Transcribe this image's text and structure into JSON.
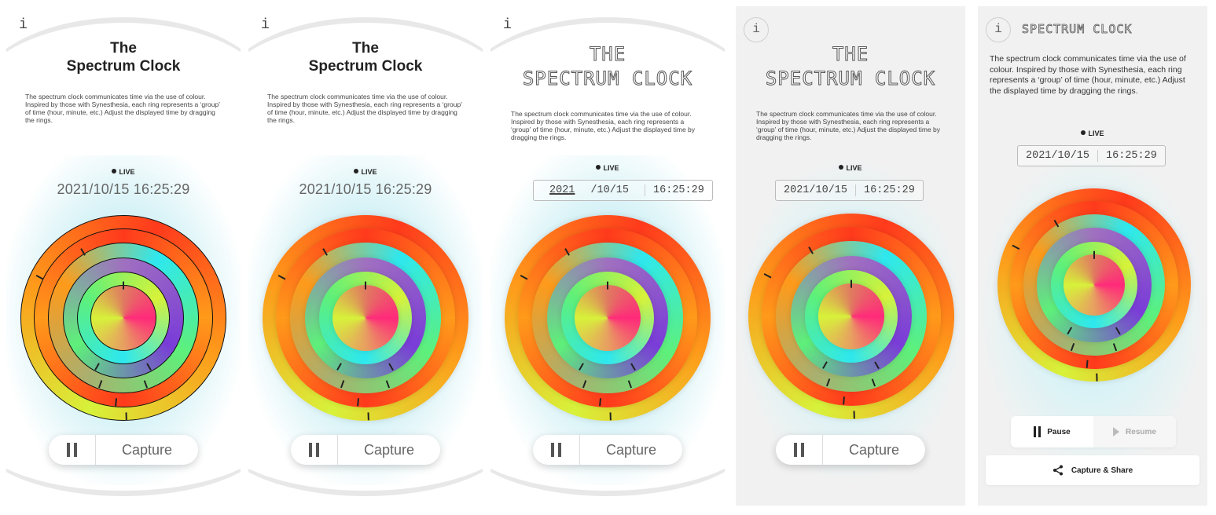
{
  "info_label": "i",
  "title_line1": "The",
  "title_line2": "Spectrum Clock",
  "title_upper_line1": "THE",
  "title_upper_line2": "SPECTRUM CLOCK",
  "description": "The spectrum clock communicates time via the use of colour. Inspired by those with Synesthesia, each ring represents a ‘group’ of time (hour, minute, etc.) Adjust the displayed time by dragging the rings.",
  "live_label": "LIVE",
  "datetime": "2021/10/15 16:25:29",
  "date": "2021/10/15",
  "date_year": "2021",
  "date_rest": "/10/15",
  "time": "16:25:29",
  "capture_label": "Capture",
  "pause_label": "Pause",
  "resume_label": "Resume",
  "capture_share_label": "Capture & Share",
  "colors": {
    "background": "#ffffff",
    "panel_gray": "#f1f1f1",
    "glow": "#bfeaf2",
    "ring_red": "#ff3a1c",
    "ring_orange": "#ff9a1a",
    "ring_yellow": "#d7f23a",
    "ring_cyan": "#2ee8ef",
    "ring_purple": "#7a3cd8",
    "ring_green": "#5ef07a",
    "ring_pink": "#ff2a7a"
  },
  "icons": [
    "info-icon",
    "pause-icon",
    "play-icon",
    "share-icon"
  ]
}
